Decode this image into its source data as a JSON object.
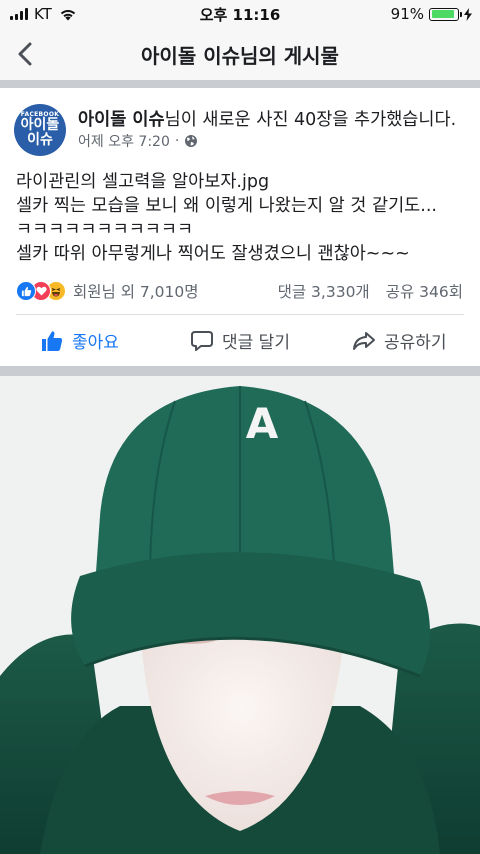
{
  "status_bar": {
    "carrier": "KT",
    "time": "오후 11:16",
    "battery_percent": "91%",
    "battery_level": 0.91
  },
  "nav": {
    "title": "아이돌 이슈님의 게시물",
    "back_icon": "chevron-left-icon"
  },
  "post": {
    "avatar": {
      "small_text": "FACEBOOK",
      "line1": "아이돌",
      "line2": "이슈",
      "color": "#2a5ea8"
    },
    "page_name": "아이돌 이슈",
    "action_text": "님이 새로운 사진 40장을 추가했습니다.",
    "timestamp": "어제 오후 7:20",
    "privacy_icon": "globe-icon",
    "body_lines": [
      "라이관린의 셀고력을 알아보자.jpg",
      "셀카 찍는 모습을 보니 왜 이렇게 나왔는지 알 것 같기도...",
      "ㅋㅋㅋㅋㅋㅋㅋㅋㅋㅋㅋ",
      "셀카 따위 아무렇게나 찍어도 잘생겼으니 괜찮아~~~"
    ]
  },
  "stats": {
    "reactions_text": "회원님 외 7,010명",
    "comments": "댓글 3,330개",
    "shares": "공유 346회",
    "reaction_icons": [
      "like-icon",
      "love-icon",
      "haha-icon"
    ]
  },
  "actions": {
    "like": "좋아요",
    "comment": "댓글 달기",
    "share": "공유하기"
  },
  "photo": {
    "cap_letter": "A",
    "cap_color": "#1f6b57"
  },
  "colors": {
    "accent": "#1877f2",
    "bar_bg": "#f7f7f7",
    "divider": "#c9ccd1"
  }
}
